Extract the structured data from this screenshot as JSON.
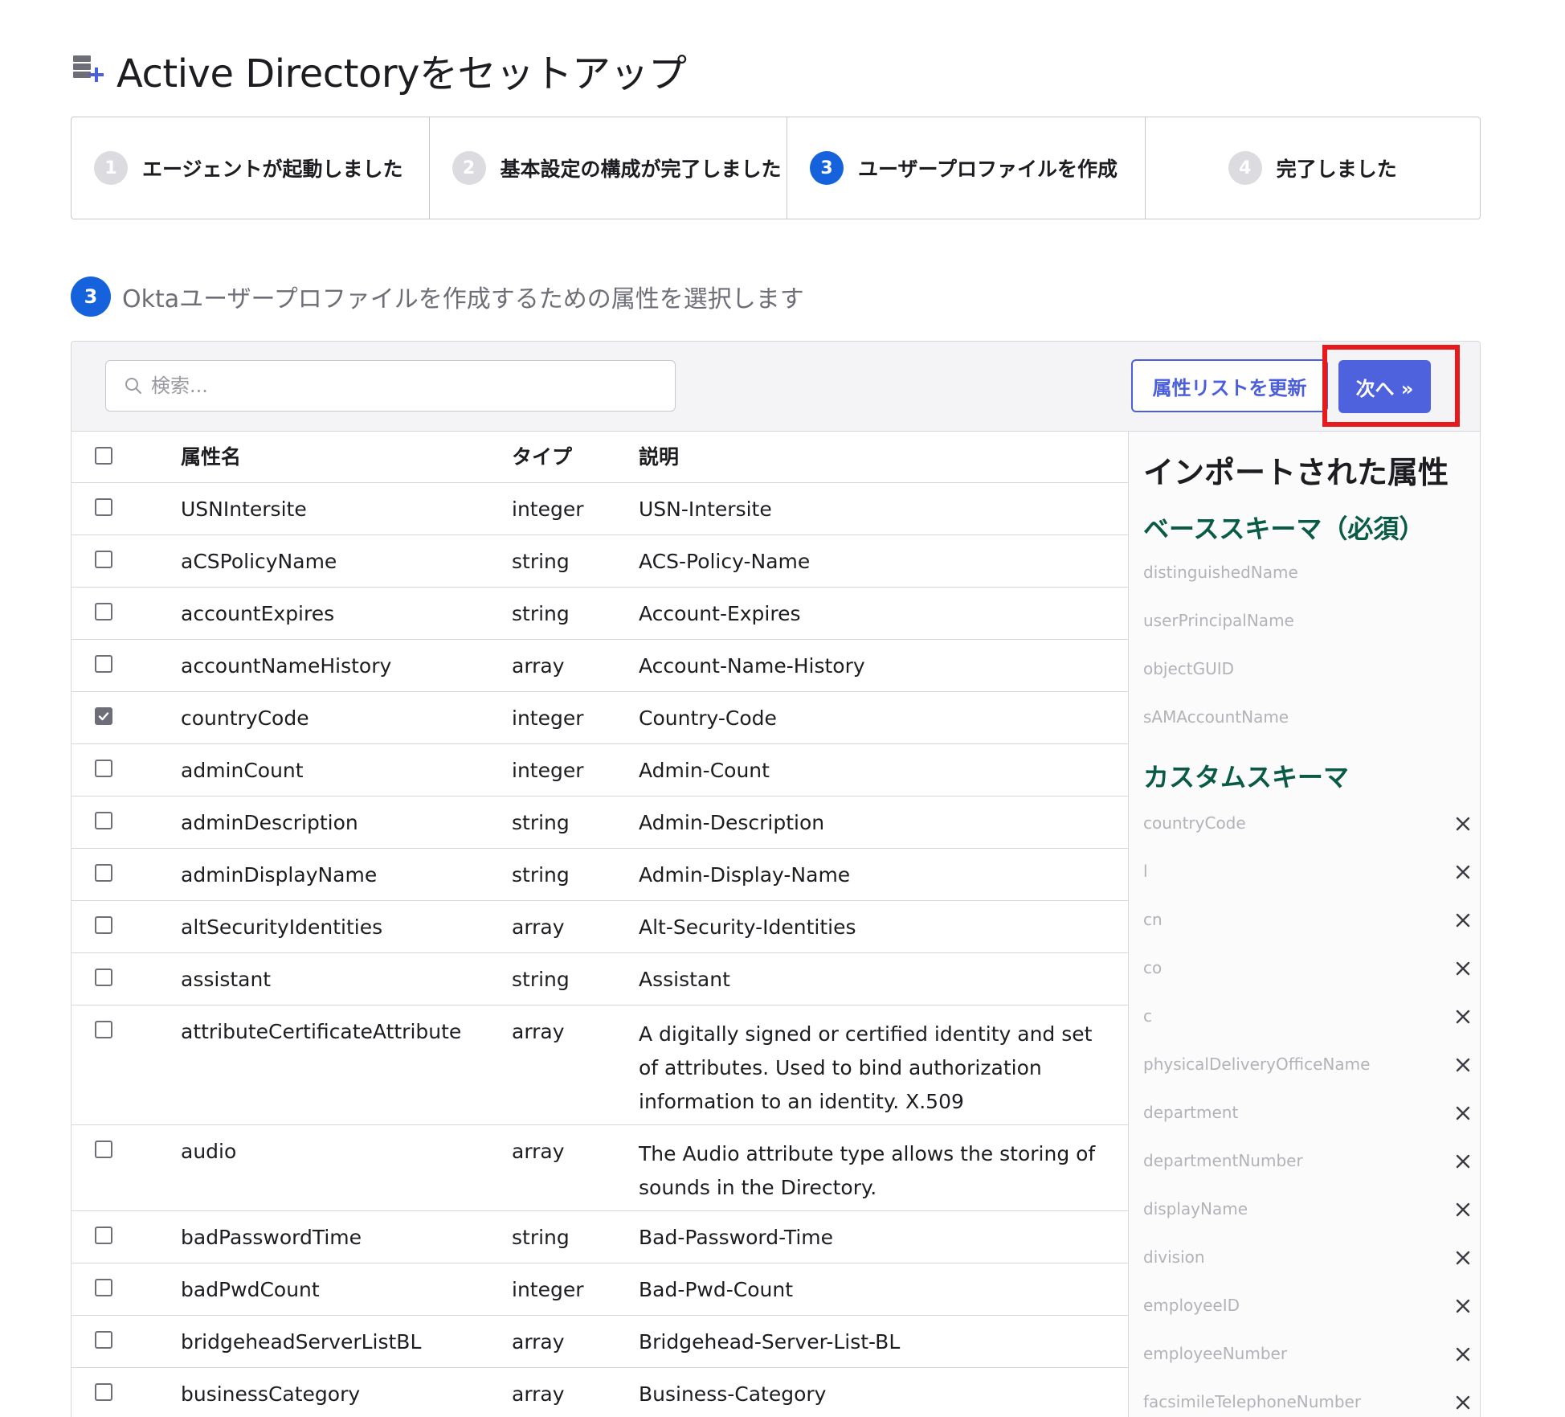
{
  "page": {
    "title": "Active Directoryをセットアップ"
  },
  "stepper": {
    "steps": [
      {
        "number": "1",
        "label": "エージェントが起動しました",
        "state": "done"
      },
      {
        "number": "2",
        "label": "基本設定の構成が完了しました",
        "state": "done"
      },
      {
        "number": "3",
        "label": "ユーザープロファイルを作成",
        "state": "active"
      },
      {
        "number": "4",
        "label": "完了しました",
        "state": "pending"
      }
    ]
  },
  "section": {
    "number": "3",
    "title": "Oktaユーザープロファイルを作成するための属性を選択します"
  },
  "toolbar": {
    "search_placeholder": "検索...",
    "refresh_label": "属性リストを更新",
    "next_label": "次へ »"
  },
  "table": {
    "headers": {
      "name": "属性名",
      "type": "タイプ",
      "desc": "説明"
    },
    "rows": [
      {
        "name": "USNIntersite",
        "type": "integer",
        "desc": "USN-Intersite",
        "checked": false
      },
      {
        "name": "aCSPolicyName",
        "type": "string",
        "desc": "ACS-Policy-Name",
        "checked": false
      },
      {
        "name": "accountExpires",
        "type": "string",
        "desc": "Account-Expires",
        "checked": false
      },
      {
        "name": "accountNameHistory",
        "type": "array",
        "desc": "Account-Name-History",
        "checked": false
      },
      {
        "name": "countryCode",
        "type": "integer",
        "desc": "Country-Code",
        "checked": true
      },
      {
        "name": "adminCount",
        "type": "integer",
        "desc": "Admin-Count",
        "checked": false
      },
      {
        "name": "adminDescription",
        "type": "string",
        "desc": "Admin-Description",
        "checked": false
      },
      {
        "name": "adminDisplayName",
        "type": "string",
        "desc": "Admin-Display-Name",
        "checked": false
      },
      {
        "name": "altSecurityIdentities",
        "type": "array",
        "desc": "Alt-Security-Identities",
        "checked": false
      },
      {
        "name": "assistant",
        "type": "string",
        "desc": "Assistant",
        "checked": false
      },
      {
        "name": "attributeCertificateAttribute",
        "type": "array",
        "desc": "A digitally signed or certified identity and set of attributes. Used to bind authorization information to an identity. X.509",
        "checked": false
      },
      {
        "name": "audio",
        "type": "array",
        "desc": "The Audio attribute type allows the storing of sounds in the Directory.",
        "checked": false
      },
      {
        "name": "badPasswordTime",
        "type": "string",
        "desc": "Bad-Password-Time",
        "checked": false
      },
      {
        "name": "badPwdCount",
        "type": "integer",
        "desc": "Bad-Pwd-Count",
        "checked": false
      },
      {
        "name": "bridgeheadServerListBL",
        "type": "array",
        "desc": "Bridgehead-Server-List-BL",
        "checked": false
      },
      {
        "name": "businessCategory",
        "type": "array",
        "desc": "Business-Category",
        "checked": false
      }
    ]
  },
  "imported": {
    "title": "インポートされた属性",
    "base_title": "ベーススキーマ（必須）",
    "base_items": [
      "distinguishedName",
      "userPrincipalName",
      "objectGUID",
      "sAMAccountName"
    ],
    "custom_title": "カスタムスキーマ",
    "custom_items": [
      "countryCode",
      "l",
      "cn",
      "co",
      "c",
      "physicalDeliveryOfficeName",
      "department",
      "departmentNumber",
      "displayName",
      "division",
      "employeeID",
      "employeeNumber",
      "facsimileTelephoneNumber"
    ]
  },
  "colors": {
    "accent": "#1662dd",
    "button": "#4e62de",
    "highlight": "#e8191a",
    "schema_heading": "#0a5b46"
  }
}
